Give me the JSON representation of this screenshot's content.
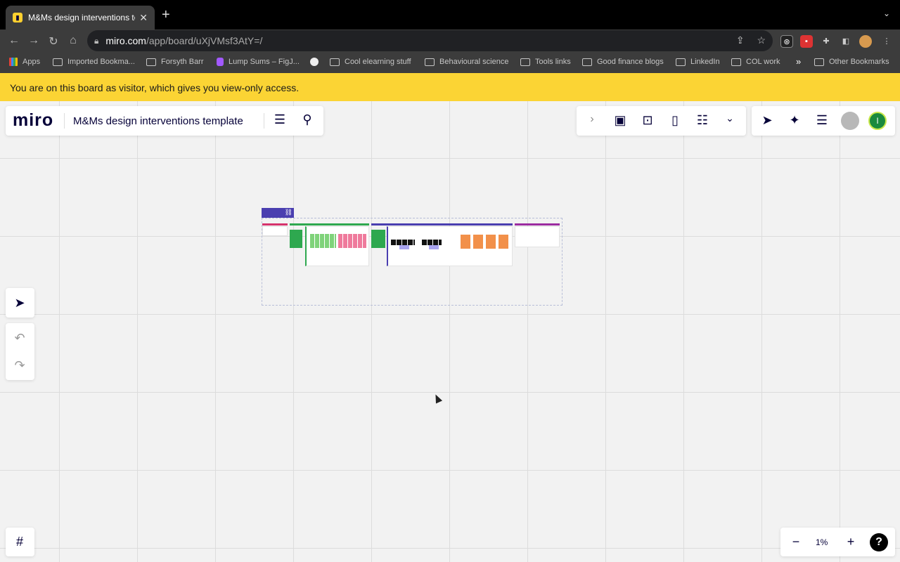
{
  "browser": {
    "tab_title": "M&Ms design interventions te",
    "new_tab": "+",
    "url_domain": "miro.com",
    "url_path": "/app/board/uXjVMsf3AtY=/",
    "bookmarks": [
      "Apps",
      "Imported Bookma...",
      "Forsyth Barr",
      "Lump Sums – FigJ...",
      "Cool elearning stuff",
      "Behavioural science",
      "Tools links",
      "Good finance blogs",
      "LinkedIn",
      "COL work"
    ],
    "more_bookmarks": "»",
    "other_bookmarks": "Other Bookmarks"
  },
  "banner": {
    "text": "You are on this board as visitor, which gives you view-only access."
  },
  "miro": {
    "logo": "miro",
    "board_title": "M&Ms design interventions template",
    "avatar_initial": "I",
    "zoom": "1%",
    "help": "?"
  },
  "colors": {
    "banner": "#fbd434",
    "brand_dark": "#050038",
    "frame_purple": "#4a3fb0",
    "green": "#2ea84f",
    "pink": "#e05a87",
    "orange": "#f2904a",
    "lavender": "#a9a4f0"
  }
}
